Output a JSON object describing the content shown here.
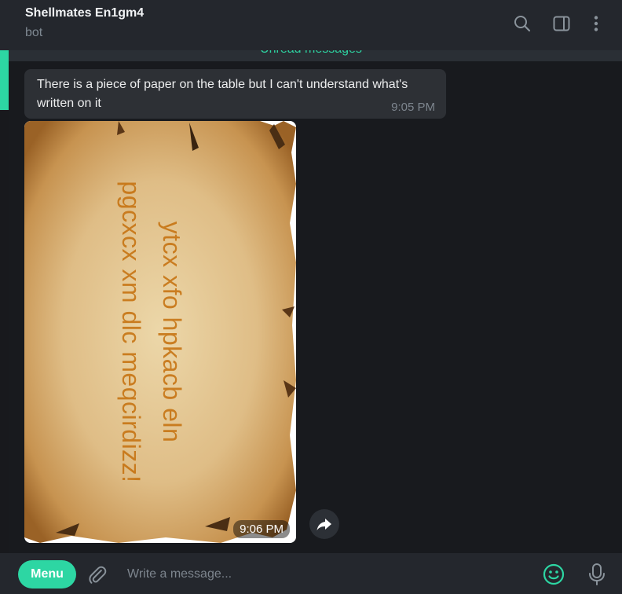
{
  "header": {
    "title": "Shellmates En1gm4",
    "subtitle": "bot",
    "icons": [
      "search-icon",
      "sidebar-panel-icon",
      "more-vertical-icon"
    ]
  },
  "chat": {
    "unread_label": "Unread messages",
    "messages": [
      {
        "text": "There is a piece of paper on the table but I can't understand what's written on it",
        "time": "9:05 PM"
      },
      {
        "type": "photo",
        "image_text": [
          "ytcx xfo hpkacb eln",
          "pgcxcx xm dlc meqcirdizz!"
        ],
        "time": "9:06 PM"
      }
    ]
  },
  "composer": {
    "menu_label": "Menu",
    "placeholder": "Write a message...",
    "icons": [
      "attach-icon",
      "emoji-icon",
      "microphone-icon"
    ]
  },
  "colors": {
    "accent": "#2dd6a3",
    "header_bg": "#24272d",
    "chat_bg": "#181a1e",
    "bubble_bg": "#2d3035"
  }
}
